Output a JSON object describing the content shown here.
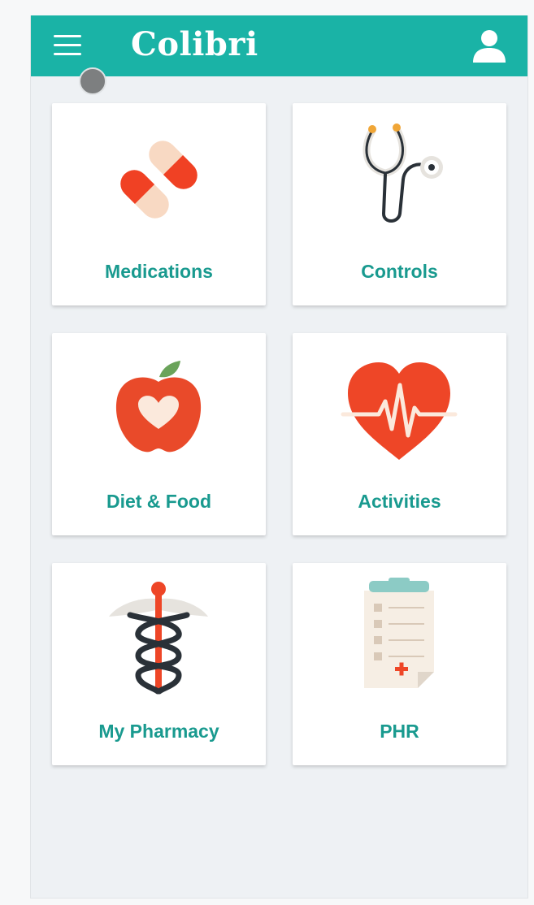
{
  "app": {
    "title": "Colibri"
  },
  "colors": {
    "primary": "#1ab3a6",
    "label": "#199a8f",
    "background": "#eef1f4",
    "accent_red": "#f04124"
  },
  "header": {
    "menu_icon": "hamburger-menu-icon",
    "profile_icon": "user-profile-icon"
  },
  "tiles": [
    {
      "label": "Medications",
      "icon": "pills-icon"
    },
    {
      "label": "Controls",
      "icon": "stethoscope-icon"
    },
    {
      "label": "Diet & Food",
      "icon": "apple-heart-icon"
    },
    {
      "label": "Activities",
      "icon": "heartbeat-icon"
    },
    {
      "label": "My Pharmacy",
      "icon": "caduceus-icon"
    },
    {
      "label": "PHR",
      "icon": "clipboard-icon"
    }
  ]
}
